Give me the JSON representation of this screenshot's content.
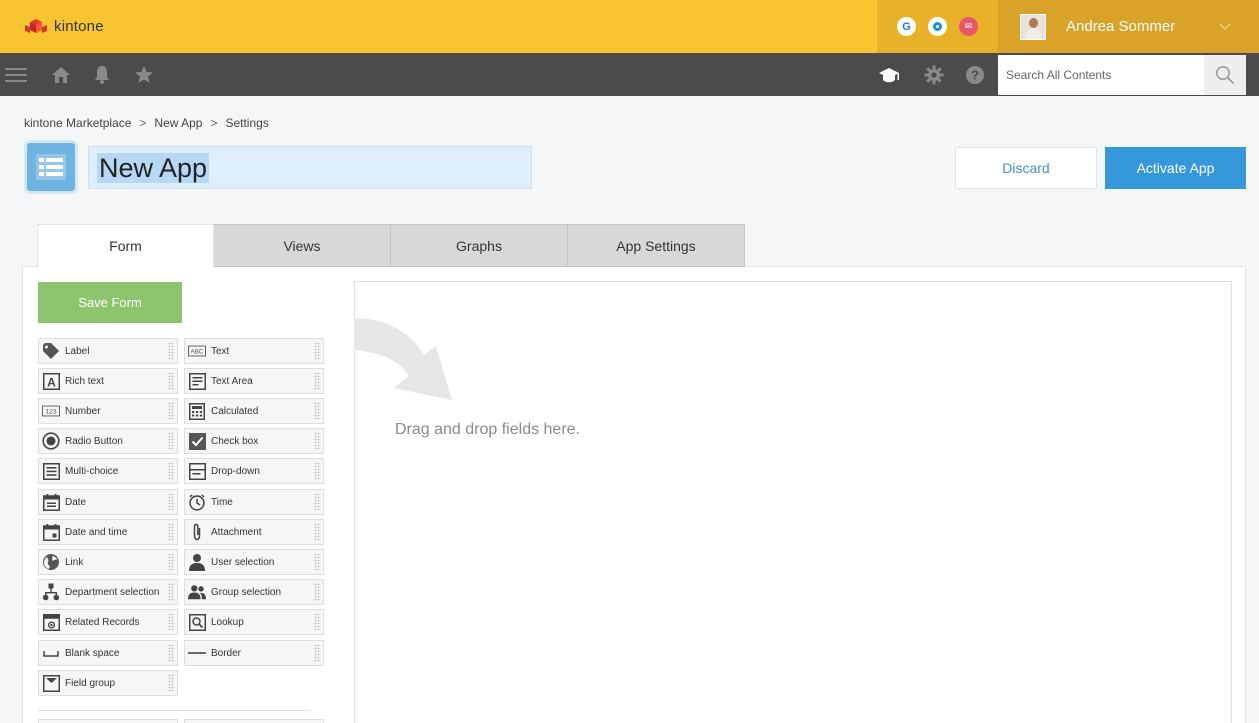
{
  "topbar": {
    "brand": "kintone",
    "apps": [
      {
        "name": "google-app-icon",
        "glyph": "G"
      },
      {
        "name": "office-app-icon",
        "glyph": ""
      },
      {
        "name": "mail-app-icon",
        "glyph": "✉"
      }
    ],
    "user_name": "Andrea Sommer"
  },
  "navbar": {
    "search_placeholder": "Search All Contents"
  },
  "breadcrumb": [
    "kintone Marketplace",
    "New App",
    "Settings"
  ],
  "breadcrumb_sep": ">",
  "app": {
    "name": "New App"
  },
  "actions": {
    "discard": "Discard",
    "activate": "Activate App"
  },
  "tabs": [
    "Form",
    "Views",
    "Graphs",
    "App Settings"
  ],
  "form": {
    "save_label": "Save Form",
    "fields": [
      {
        "label": "Label",
        "icon": "tag-icon"
      },
      {
        "label": "Text",
        "icon": "abc-icon"
      },
      {
        "label": "Rich text",
        "icon": "rich-text-icon"
      },
      {
        "label": "Text Area",
        "icon": "text-area-icon"
      },
      {
        "label": "Number",
        "icon": "number-icon"
      },
      {
        "label": "Calculated",
        "icon": "calculator-icon"
      },
      {
        "label": "Radio Button",
        "icon": "radio-icon"
      },
      {
        "label": "Check box",
        "icon": "checkbox-icon"
      },
      {
        "label": "Multi-choice",
        "icon": "multi-choice-icon"
      },
      {
        "label": "Drop-down",
        "icon": "dropdown-icon"
      },
      {
        "label": "Date",
        "icon": "date-icon"
      },
      {
        "label": "Time",
        "icon": "clock-icon"
      },
      {
        "label": "Date and time",
        "icon": "calendar-icon"
      },
      {
        "label": "Attachment",
        "icon": "paperclip-icon"
      },
      {
        "label": "Link",
        "icon": "globe-icon"
      },
      {
        "label": "User selection",
        "icon": "user-icon"
      },
      {
        "label": "Department selection",
        "icon": "org-chart-icon"
      },
      {
        "label": "Group selection",
        "icon": "group-icon"
      },
      {
        "label": "Related Records",
        "icon": "related-records-icon"
      },
      {
        "label": "Lookup",
        "icon": "lookup-icon"
      },
      {
        "label": "Blank space",
        "icon": "blank-space-icon"
      },
      {
        "label": "Border",
        "icon": "border-line-icon"
      },
      {
        "label": "Field group",
        "icon": "field-group-icon"
      }
    ],
    "drop_hint": "Drag and drop fields here."
  },
  "colors": {
    "topbar": "#f8c42f",
    "navbar": "#4b4b4b",
    "accent": "#3498db",
    "save": "#8fc46e"
  }
}
